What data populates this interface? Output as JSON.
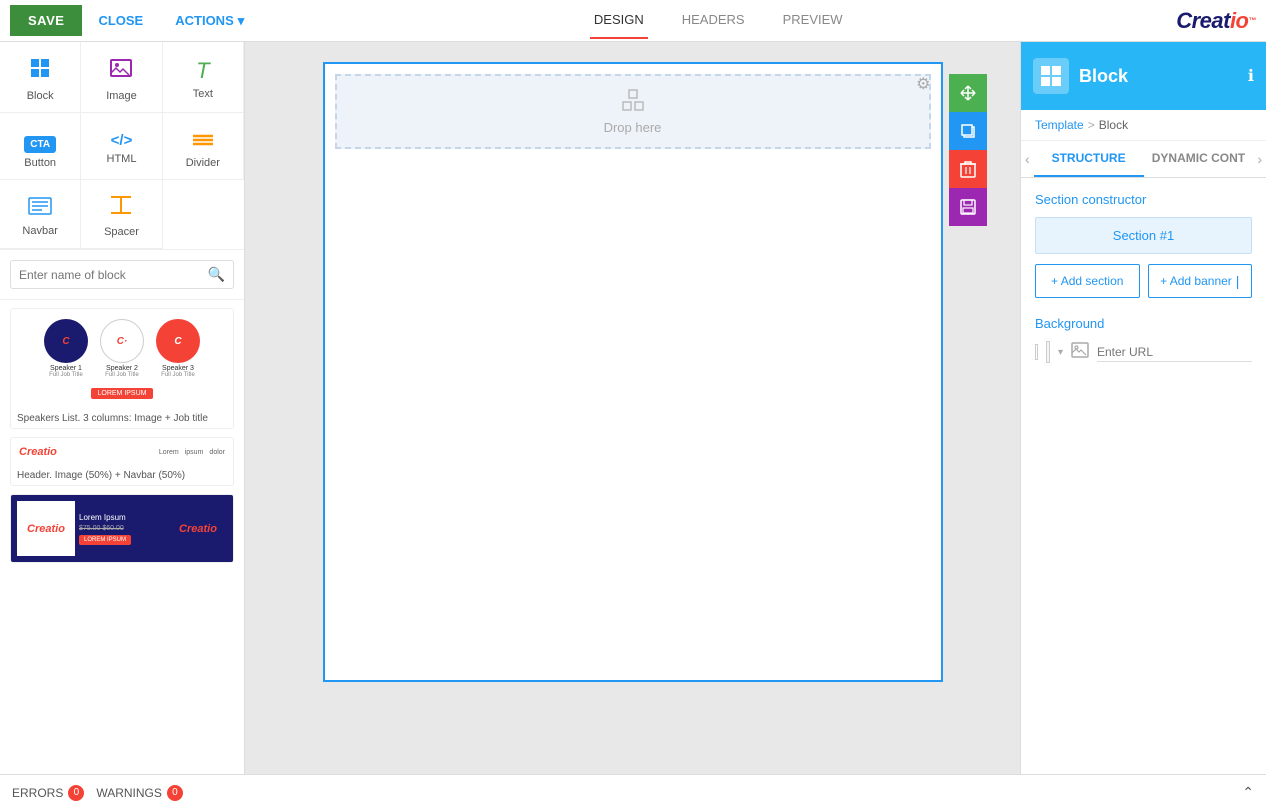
{
  "toolbar": {
    "save_label": "SAVE",
    "close_label": "CLOSE",
    "actions_label": "ACTIONS",
    "tabs": [
      {
        "label": "DESIGN",
        "active": true
      },
      {
        "label": "HEADERS",
        "active": false
      },
      {
        "label": "PREVIEW",
        "active": false
      }
    ]
  },
  "logo": {
    "text": "Creatio"
  },
  "sidebar": {
    "items": [
      {
        "id": "block",
        "label": "Block",
        "icon": "⊞"
      },
      {
        "id": "image",
        "label": "Image",
        "icon": "🖼"
      },
      {
        "id": "text",
        "label": "Text",
        "icon": "T"
      },
      {
        "id": "button",
        "label": "Button",
        "icon": "CTA"
      },
      {
        "id": "html",
        "label": "HTML",
        "icon": "</>"
      },
      {
        "id": "divider",
        "label": "Divider",
        "icon": "≡"
      },
      {
        "id": "navbar",
        "label": "Navbar",
        "icon": "☰"
      },
      {
        "id": "spacer",
        "label": "Spacer",
        "icon": "↕"
      }
    ],
    "search_placeholder": "Enter name of block",
    "block_previews": [
      {
        "label": "Speakers List. 3 columns: Image + Job title"
      },
      {
        "label": "Header. Image (50%) + Navbar (50%)"
      },
      {
        "label": ""
      }
    ]
  },
  "canvas": {
    "drop_label": "Drop here",
    "gear_tooltip": "Settings"
  },
  "side_actions": [
    {
      "id": "move",
      "icon": "✥",
      "color": "#4caf50"
    },
    {
      "id": "copy",
      "icon": "⧉",
      "color": "#2196f3"
    },
    {
      "id": "delete",
      "icon": "🗑",
      "color": "#f44336"
    },
    {
      "id": "save",
      "icon": "💾",
      "color": "#9c27b0"
    }
  ],
  "right_panel": {
    "header": {
      "icon": "⊞",
      "title": "Block",
      "info_icon": "ℹ"
    },
    "breadcrumb": {
      "template": "Template",
      "sep": ">",
      "current": "Block"
    },
    "tabs": [
      {
        "label": "STRUCTURE",
        "active": true
      },
      {
        "label": "DYNAMIC CONT",
        "active": false
      }
    ],
    "section_constructor_title": "Section constructor",
    "section_item_label": "Section #1",
    "add_section_label": "+ Add section",
    "add_banner_label": "+ Add banner",
    "background_title": "Background",
    "url_placeholder": "Enter URL"
  },
  "bottom_bar": {
    "errors_label": "ERRORS",
    "errors_count": "0",
    "warnings_label": "WARNINGS",
    "warnings_count": "0"
  }
}
